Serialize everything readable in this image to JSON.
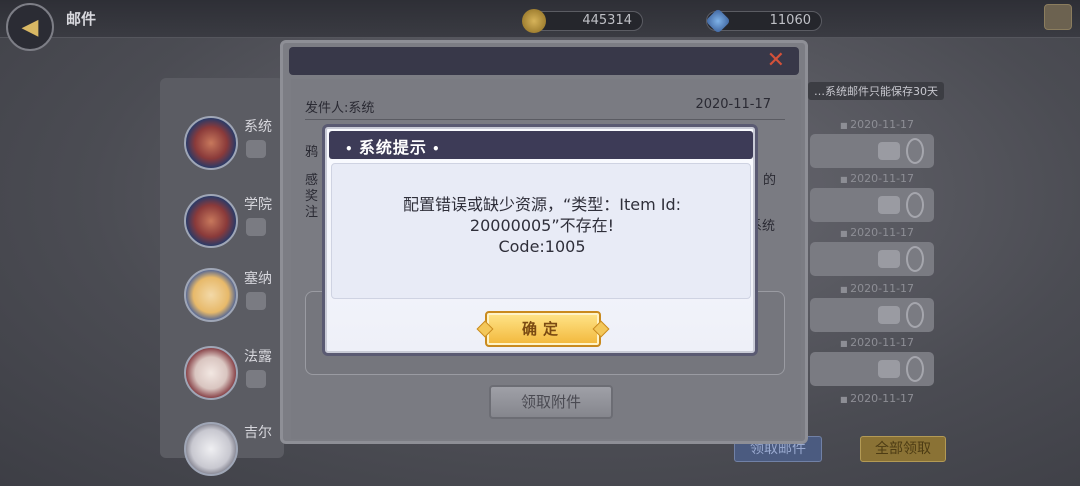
{
  "topbar": {
    "title": "邮件",
    "gold": "445314",
    "gems": "11060"
  },
  "mail_list": [
    {
      "name": "系统"
    },
    {
      "name": "学院"
    },
    {
      "name": "塞纳"
    },
    {
      "name": "法露"
    },
    {
      "name": "吉尔"
    }
  ],
  "tip_banner": "…系统邮件只能保存30天",
  "right_dates": [
    "2020-11-17",
    "2020-11-17",
    "2020-11-17",
    "2020-11-17",
    "2020-11-17",
    "2020-11-17"
  ],
  "bottom_buttons": {
    "claim_read": "领取邮件",
    "claim_all": "全部领取"
  },
  "mail_detail": {
    "sender": "发件人:系统",
    "date": "2020-11-17",
    "frag1": "鸦",
    "frag2": "感",
    "frag3": "奖",
    "frag4": "注",
    "frag5": "的",
    "frag6": "系统",
    "receive_button": "领取附件"
  },
  "system_prompt": {
    "title": "系统提示",
    "line1": "配置错误或缺少资源，“类型：Item  Id:",
    "line2": "20000005”不存在!",
    "line3": "Code:1005",
    "confirm": "确定"
  },
  "colors": {
    "accent_gold": "#f2b73a",
    "close_red": "#d3513a",
    "dialog_header": "#3d3b57"
  }
}
